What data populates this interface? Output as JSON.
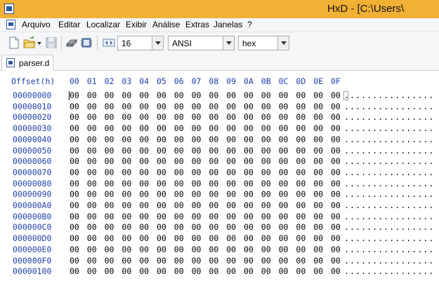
{
  "titlebar": {
    "title": "HxD - [C:\\Users\\"
  },
  "menu": [
    "Arquivo",
    "Editar",
    "Localizar",
    "Exibir",
    "Análise",
    "Extras",
    "Janelas",
    "?"
  ],
  "toolbar": {
    "icons": [
      "new-file-icon",
      "open-folder-icon",
      "dropdown-arrow-icon",
      "save-icon",
      "disk-icon",
      "ram-icon",
      "columns-icon"
    ],
    "columns_value": "16",
    "charset_value": "ANSI",
    "offset_base_value": "hex"
  },
  "tabs": [
    {
      "label": "parser.d"
    }
  ],
  "hex": {
    "offset_header": "Offset(h)",
    "column_headers": [
      "00",
      "01",
      "02",
      "03",
      "04",
      "05",
      "06",
      "07",
      "08",
      "09",
      "0A",
      "0B",
      "0C",
      "0D",
      "0E",
      "0F"
    ],
    "rows": [
      {
        "offset": "00000000",
        "bytes": [
          "00",
          "00",
          "00",
          "00",
          "00",
          "00",
          "00",
          "00",
          "00",
          "00",
          "00",
          "00",
          "00",
          "00",
          "00",
          "00"
        ],
        "text": "................"
      },
      {
        "offset": "00000010",
        "bytes": [
          "00",
          "00",
          "00",
          "00",
          "00",
          "00",
          "00",
          "00",
          "00",
          "00",
          "00",
          "00",
          "00",
          "00",
          "00",
          "00"
        ],
        "text": "................"
      },
      {
        "offset": "00000020",
        "bytes": [
          "00",
          "00",
          "00",
          "00",
          "00",
          "00",
          "00",
          "00",
          "00",
          "00",
          "00",
          "00",
          "00",
          "00",
          "00",
          "00"
        ],
        "text": "................"
      },
      {
        "offset": "00000030",
        "bytes": [
          "00",
          "00",
          "00",
          "00",
          "00",
          "00",
          "00",
          "00",
          "00",
          "00",
          "00",
          "00",
          "00",
          "00",
          "00",
          "00"
        ],
        "text": "................"
      },
      {
        "offset": "00000040",
        "bytes": [
          "00",
          "00",
          "00",
          "00",
          "00",
          "00",
          "00",
          "00",
          "00",
          "00",
          "00",
          "00",
          "00",
          "00",
          "00",
          "00"
        ],
        "text": "................"
      },
      {
        "offset": "00000050",
        "bytes": [
          "00",
          "00",
          "00",
          "00",
          "00",
          "00",
          "00",
          "00",
          "00",
          "00",
          "00",
          "00",
          "00",
          "00",
          "00",
          "00"
        ],
        "text": "................"
      },
      {
        "offset": "00000060",
        "bytes": [
          "00",
          "00",
          "00",
          "00",
          "00",
          "00",
          "00",
          "00",
          "00",
          "00",
          "00",
          "00",
          "00",
          "00",
          "00",
          "00"
        ],
        "text": "................"
      },
      {
        "offset": "00000070",
        "bytes": [
          "00",
          "00",
          "00",
          "00",
          "00",
          "00",
          "00",
          "00",
          "00",
          "00",
          "00",
          "00",
          "00",
          "00",
          "00",
          "00"
        ],
        "text": "................"
      },
      {
        "offset": "00000080",
        "bytes": [
          "00",
          "00",
          "00",
          "00",
          "00",
          "00",
          "00",
          "00",
          "00",
          "00",
          "00",
          "00",
          "00",
          "00",
          "00",
          "00"
        ],
        "text": "................"
      },
      {
        "offset": "00000090",
        "bytes": [
          "00",
          "00",
          "00",
          "00",
          "00",
          "00",
          "00",
          "00",
          "00",
          "00",
          "00",
          "00",
          "00",
          "00",
          "00",
          "00"
        ],
        "text": "................"
      },
      {
        "offset": "000000A0",
        "bytes": [
          "00",
          "00",
          "00",
          "00",
          "00",
          "00",
          "00",
          "00",
          "00",
          "00",
          "00",
          "00",
          "00",
          "00",
          "00",
          "00"
        ],
        "text": "................"
      },
      {
        "offset": "000000B0",
        "bytes": [
          "00",
          "00",
          "00",
          "00",
          "00",
          "00",
          "00",
          "00",
          "00",
          "00",
          "00",
          "00",
          "00",
          "00",
          "00",
          "00"
        ],
        "text": "................"
      },
      {
        "offset": "000000C0",
        "bytes": [
          "00",
          "00",
          "00",
          "00",
          "00",
          "00",
          "00",
          "00",
          "00",
          "00",
          "00",
          "00",
          "00",
          "00",
          "00",
          "00"
        ],
        "text": "................"
      },
      {
        "offset": "000000D0",
        "bytes": [
          "00",
          "00",
          "00",
          "00",
          "00",
          "00",
          "00",
          "00",
          "00",
          "00",
          "00",
          "00",
          "00",
          "00",
          "00",
          "00"
        ],
        "text": "................"
      },
      {
        "offset": "000000E0",
        "bytes": [
          "00",
          "00",
          "00",
          "00",
          "00",
          "00",
          "00",
          "00",
          "00",
          "00",
          "00",
          "00",
          "00",
          "00",
          "00",
          "00"
        ],
        "text": "................"
      },
      {
        "offset": "000000F0",
        "bytes": [
          "00",
          "00",
          "00",
          "00",
          "00",
          "00",
          "00",
          "00",
          "00",
          "00",
          "00",
          "00",
          "00",
          "00",
          "00",
          "00"
        ],
        "text": "................"
      },
      {
        "offset": "00000100",
        "bytes": [
          "00",
          "00",
          "00",
          "00",
          "00",
          "00",
          "00",
          "00",
          "00",
          "00",
          "00",
          "00",
          "00",
          "00",
          "00",
          "00"
        ],
        "text": "................"
      }
    ]
  },
  "colors": {
    "titlebar": "#f2b035",
    "offset_blue": "#1f3faa"
  }
}
